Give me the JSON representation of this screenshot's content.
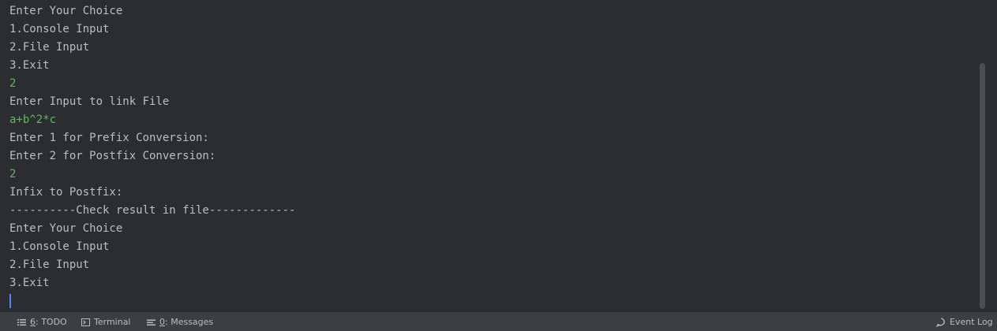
{
  "console": {
    "lines": [
      {
        "text": "Enter Your Choice",
        "kind": "output"
      },
      {
        "text": "1.Console Input",
        "kind": "output"
      },
      {
        "text": "2.File Input",
        "kind": "output"
      },
      {
        "text": "3.Exit",
        "kind": "output"
      },
      {
        "text": "2",
        "kind": "input"
      },
      {
        "text": "Enter Input to link File",
        "kind": "output"
      },
      {
        "text": "a+b^2*c",
        "kind": "input"
      },
      {
        "text": "Enter 1 for Prefix Conversion:",
        "kind": "output"
      },
      {
        "text": "Enter 2 for Postfix Conversion:",
        "kind": "output"
      },
      {
        "text": "2",
        "kind": "input"
      },
      {
        "text": "Infix to Postfix:",
        "kind": "output"
      },
      {
        "text": "----------Check result in file-------------",
        "kind": "output"
      },
      {
        "text": "Enter Your Choice",
        "kind": "output"
      },
      {
        "text": "1.Console Input",
        "kind": "output"
      },
      {
        "text": "2.File Input",
        "kind": "output"
      },
      {
        "text": "3.Exit",
        "kind": "output"
      }
    ]
  },
  "colors": {
    "background": "#2b2d30",
    "output_text": "#bcbec4",
    "input_text": "#5fb85f",
    "caret": "#4a88ff"
  },
  "statusbar": {
    "todo": {
      "mnemonic": "6",
      "label": ": TODO",
      "icon": "list-icon"
    },
    "terminal": {
      "label": "Terminal",
      "icon": "terminal-icon"
    },
    "messages": {
      "mnemonic": "0",
      "label": ": Messages",
      "icon": "messages-icon"
    },
    "event_log": {
      "label": "Event Log",
      "icon": "event-log-icon"
    }
  }
}
